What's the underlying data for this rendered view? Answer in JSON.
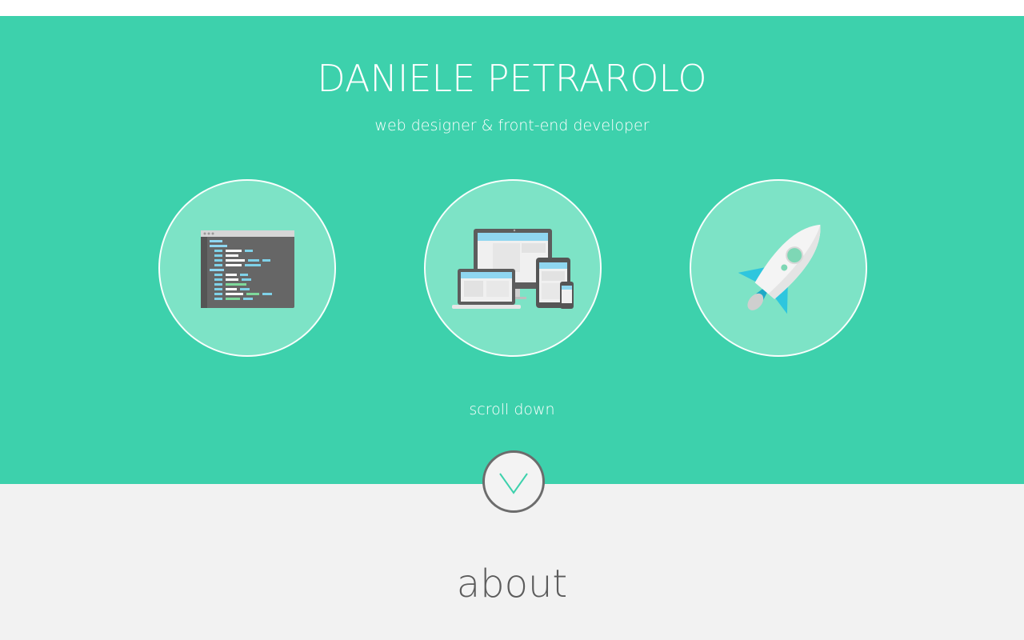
{
  "hero": {
    "title": "DANIELE PETRAROLO",
    "subtitle": "web designer & front-end developer",
    "scroll_label": "scroll down",
    "icons": [
      "code-editor-icon",
      "responsive-devices-icon",
      "rocket-icon"
    ]
  },
  "about": {
    "title": "about"
  },
  "colors": {
    "hero_bg": "#3dd1ac",
    "circle_fill": "#7de3c6",
    "lower_bg": "#f2f2f2",
    "accent": "#3dd1ac",
    "text_dark": "#5c5c5c"
  }
}
